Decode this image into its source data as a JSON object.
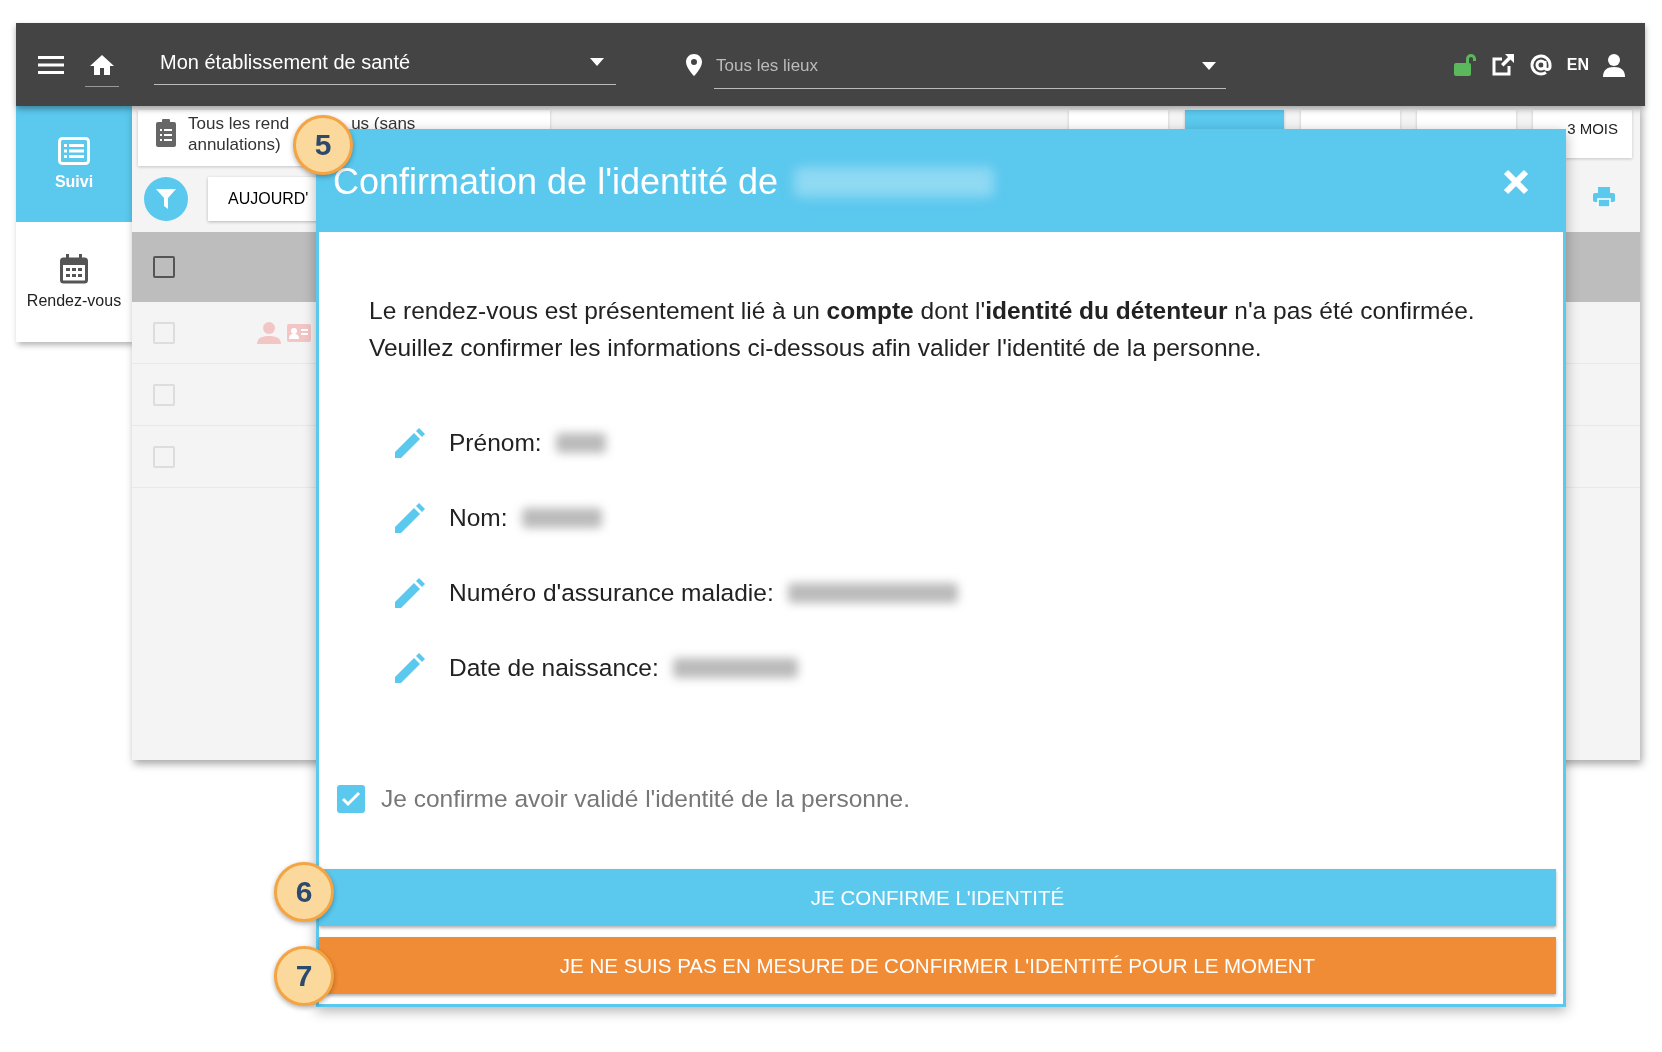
{
  "top_bar": {
    "establishment": {
      "value": "Mon établissement de santé"
    },
    "location": {
      "placeholder": "Tous les lieux"
    },
    "language": "EN"
  },
  "sidebar": {
    "items": [
      {
        "label": "Suivi",
        "selected": true,
        "kind": "list"
      },
      {
        "label": "Rendez-vous",
        "selected": false,
        "kind": "calendar"
      }
    ]
  },
  "list_view": {
    "filter": {
      "line_1_start": "Tous les rend",
      "line_1_end": "us (sans",
      "line_2": "annulations)"
    },
    "today_button": "AUJOURD'",
    "tabs": [
      {
        "selected": false
      },
      {
        "selected": true
      },
      {
        "selected": false
      },
      {
        "selected": false
      },
      {
        "label": "3 MOIS",
        "selected": false
      }
    ],
    "header_checked": false,
    "rows": [
      {
        "checked": false,
        "icons": true
      },
      {
        "checked": false,
        "icons": false
      },
      {
        "checked": false,
        "icons": false
      }
    ]
  },
  "modal": {
    "title": "Confirmation de l'identité de",
    "intro": [
      "Le rendez-vous est présentement lié à un **compte** dont l'**identité du détenteur** n'a pas été confirmée.",
      "Veuillez confirmer les informations ci-dessous afin valider l'identité de la personne."
    ],
    "fields": [
      {
        "label": "Prénom:"
      },
      {
        "label": "Nom:"
      },
      {
        "label": "Numéro d'assurance maladie:"
      },
      {
        "label": "Date de naissance:"
      }
    ],
    "confirmation": {
      "label": "Je confirme avoir validé l'identité de la personne.",
      "checked": true
    },
    "buttons": [
      {
        "label": "JE CONFIRME L'IDENTITÉ",
        "kind": "primary"
      },
      {
        "label": "JE NE SUIS PAS EN MESURE DE CONFIRMER L'IDENTITÉ POUR LE MOMENT",
        "kind": "warning"
      }
    ]
  },
  "callouts": [
    {
      "number": "5"
    },
    {
      "number": "6"
    },
    {
      "number": "7"
    }
  ]
}
